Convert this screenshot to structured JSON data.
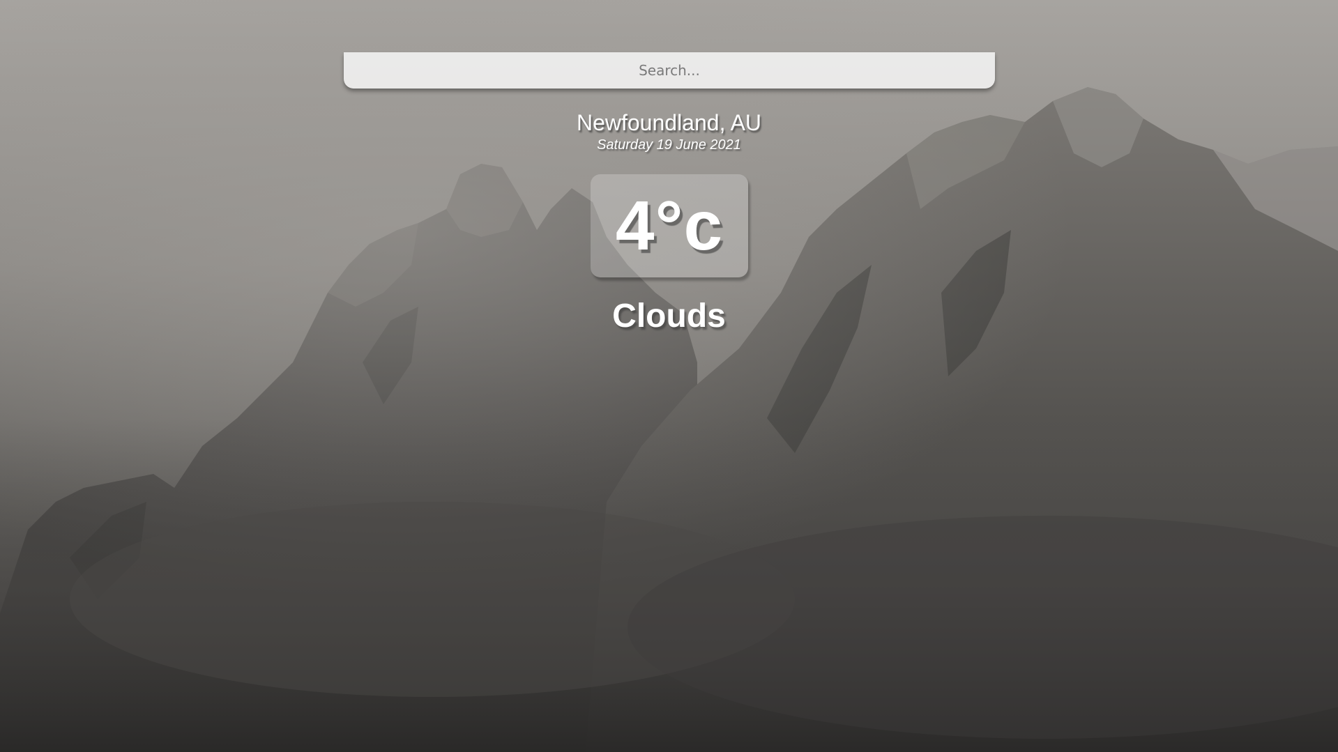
{
  "search": {
    "placeholder": "Search..."
  },
  "weather": {
    "location": "Newfoundland, AU",
    "date": "Saturday 19 June 2021",
    "temperature": "4°c",
    "condition": "Clouds"
  },
  "background": {
    "image": "foggy-snowy-mountain-peaks"
  }
}
